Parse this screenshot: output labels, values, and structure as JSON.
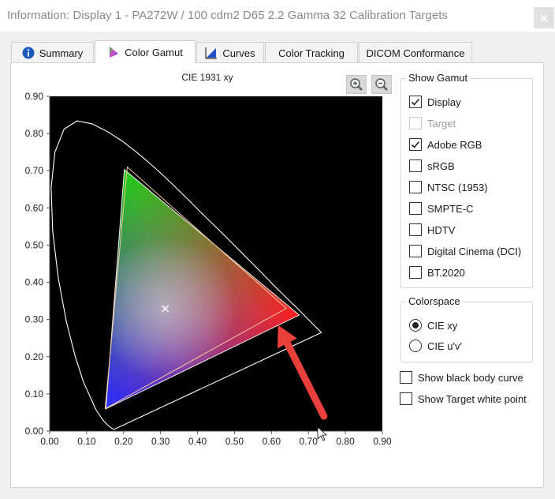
{
  "window": {
    "title": "Information: Display 1 - PA272W / 100 cdm2 D65 2.2 Gamma 32 Calibration Targets"
  },
  "tabs": [
    {
      "label": "Summary",
      "icon": "info-icon",
      "active": false
    },
    {
      "label": "Color Gamut",
      "icon": "gamut-icon",
      "active": true
    },
    {
      "label": "Curves",
      "icon": "curves-icon",
      "active": false
    },
    {
      "label": "Color Tracking",
      "icon": "",
      "active": false
    },
    {
      "label": "DICOM Conformance",
      "icon": "",
      "active": false
    }
  ],
  "chart_data": {
    "type": "scatter",
    "title": "CIE 1931 xy",
    "xlim": [
      0.0,
      0.9
    ],
    "ylim": [
      0.0,
      0.9
    ],
    "xticks": [
      "0.00",
      "0.10",
      "0.20",
      "0.30",
      "0.40",
      "0.50",
      "0.60",
      "0.70",
      "0.80",
      "0.90"
    ],
    "yticks": [
      "0.00",
      "0.10",
      "0.20",
      "0.30",
      "0.40",
      "0.50",
      "0.60",
      "0.70",
      "0.80",
      "0.90"
    ],
    "background": "#000000",
    "spectral_locus": [
      [
        0.175,
        0.005
      ],
      [
        0.172,
        0.005
      ],
      [
        0.166,
        0.009
      ],
      [
        0.155,
        0.018
      ],
      [
        0.144,
        0.03
      ],
      [
        0.125,
        0.058
      ],
      [
        0.091,
        0.133
      ],
      [
        0.069,
        0.201
      ],
      [
        0.045,
        0.295
      ],
      [
        0.023,
        0.413
      ],
      [
        0.008,
        0.538
      ],
      [
        0.004,
        0.655
      ],
      [
        0.014,
        0.75
      ],
      [
        0.039,
        0.812
      ],
      [
        0.074,
        0.834
      ],
      [
        0.115,
        0.826
      ],
      [
        0.155,
        0.806
      ],
      [
        0.193,
        0.782
      ],
      [
        0.23,
        0.754
      ],
      [
        0.266,
        0.724
      ],
      [
        0.302,
        0.692
      ],
      [
        0.337,
        0.659
      ],
      [
        0.373,
        0.624
      ],
      [
        0.408,
        0.589
      ],
      [
        0.444,
        0.554
      ],
      [
        0.479,
        0.52
      ],
      [
        0.513,
        0.486
      ],
      [
        0.547,
        0.452
      ],
      [
        0.579,
        0.42
      ],
      [
        0.608,
        0.39
      ],
      [
        0.633,
        0.366
      ],
      [
        0.654,
        0.345
      ],
      [
        0.67,
        0.33
      ],
      [
        0.683,
        0.317
      ],
      [
        0.692,
        0.308
      ],
      [
        0.7,
        0.3
      ],
      [
        0.735,
        0.265
      ]
    ],
    "display_gamut": {
      "r": [
        0.675,
        0.312
      ],
      "g": [
        0.202,
        0.703
      ],
      "b": [
        0.152,
        0.06
      ]
    },
    "adobe_rgb_gamut": {
      "r": [
        0.64,
        0.33
      ],
      "g": [
        0.21,
        0.71
      ],
      "b": [
        0.15,
        0.06
      ]
    },
    "white_point": [
      0.3127,
      0.329
    ],
    "annotation_arrow": {
      "from": [
        0.742,
        0.04
      ],
      "to": [
        0.618,
        0.285
      ],
      "color": "#e8413c"
    }
  },
  "show_gamut": {
    "label": "Show Gamut",
    "options": [
      {
        "label": "Display",
        "checked": true,
        "enabled": true
      },
      {
        "label": "Target",
        "checked": false,
        "enabled": false
      },
      {
        "label": "Adobe RGB",
        "checked": true,
        "enabled": true
      },
      {
        "label": "sRGB",
        "checked": false,
        "enabled": true
      },
      {
        "label": "NTSC (1953)",
        "checked": false,
        "enabled": true
      },
      {
        "label": "SMPTE-C",
        "checked": false,
        "enabled": true
      },
      {
        "label": "HDTV",
        "checked": false,
        "enabled": true
      },
      {
        "label": "Digital Cinema (DCI)",
        "checked": false,
        "enabled": true
      },
      {
        "label": "BT.2020",
        "checked": false,
        "enabled": true
      }
    ]
  },
  "colorspace": {
    "label": "Colorspace",
    "options": [
      {
        "label": "CIE xy",
        "selected": true
      },
      {
        "label": "CIE u'v'",
        "selected": false
      }
    ]
  },
  "options": {
    "black_body": {
      "label": "Show black body curve",
      "checked": false
    },
    "target_white": {
      "label": "Show Target white point",
      "checked": false
    }
  }
}
